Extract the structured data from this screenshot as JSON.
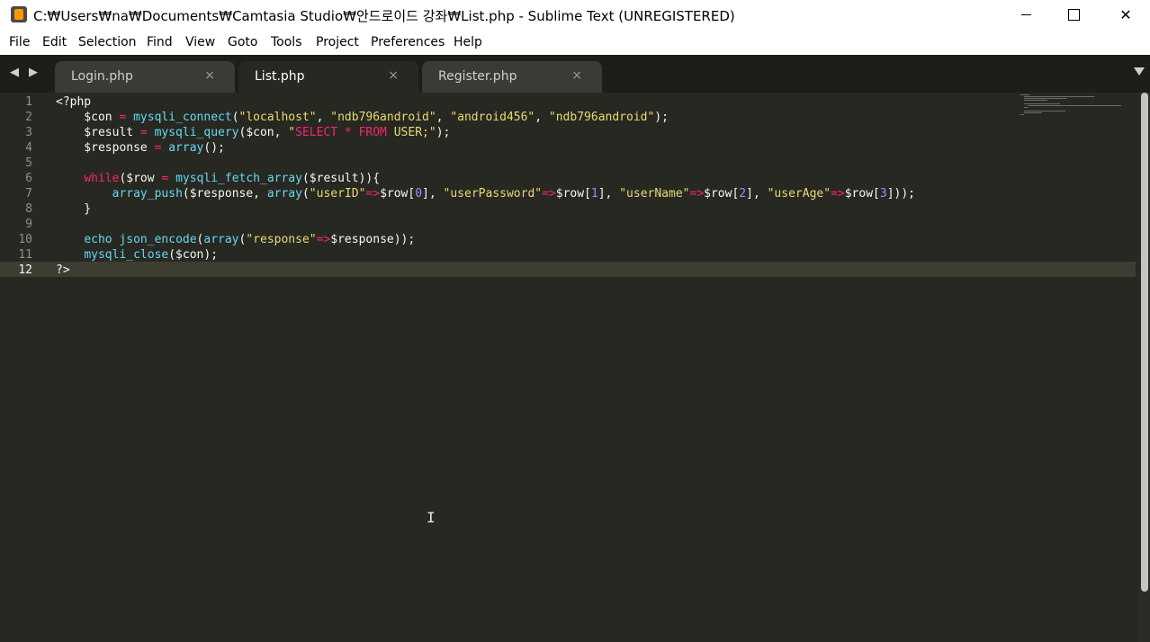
{
  "window": {
    "title": "C:₩Users₩na₩Documents₩Camtasia Studio₩안드로이드 강좌₩List.php - Sublime Text (UNREGISTERED)",
    "minimize_icon": "minimize-icon",
    "maximize_icon": "maximize-icon",
    "close_glyph": "✕"
  },
  "menu": [
    "File",
    "Edit",
    "Selection",
    "Find",
    "View",
    "Goto",
    "Tools",
    "Project",
    "Preferences",
    "Help"
  ],
  "tabs": [
    {
      "label": "Login.php",
      "close": "×",
      "active": false
    },
    {
      "label": "List.php",
      "close": "×",
      "active": true
    },
    {
      "label": "Register.php",
      "close": "×",
      "active": false
    }
  ],
  "nav": {
    "back": "◀",
    "forward": "▶"
  },
  "editor": {
    "current_line": 12,
    "line_numbers": [
      "1",
      "2",
      "3",
      "4",
      "5",
      "6",
      "7",
      "8",
      "9",
      "10",
      "11",
      "12"
    ],
    "lines": [
      [
        {
          "t": "<?php",
          "c": "plain"
        }
      ],
      [
        {
          "t": "    $con ",
          "c": "plain"
        },
        {
          "t": "=",
          "c": "kw"
        },
        {
          "t": " ",
          "c": "plain"
        },
        {
          "t": "mysqli_connect",
          "c": "fn"
        },
        {
          "t": "(",
          "c": "plain"
        },
        {
          "t": "\"localhost\"",
          "c": "str"
        },
        {
          "t": ", ",
          "c": "plain"
        },
        {
          "t": "\"ndb796android\"",
          "c": "str"
        },
        {
          "t": ", ",
          "c": "plain"
        },
        {
          "t": "\"android456\"",
          "c": "str"
        },
        {
          "t": ", ",
          "c": "plain"
        },
        {
          "t": "\"ndb796android\"",
          "c": "str"
        },
        {
          "t": ");",
          "c": "plain"
        }
      ],
      [
        {
          "t": "    $result ",
          "c": "plain"
        },
        {
          "t": "=",
          "c": "kw"
        },
        {
          "t": " ",
          "c": "plain"
        },
        {
          "t": "mysqli_query",
          "c": "fn"
        },
        {
          "t": "($con, ",
          "c": "plain"
        },
        {
          "t": "\"",
          "c": "str"
        },
        {
          "t": "SELECT",
          "c": "kw"
        },
        {
          "t": " ",
          "c": "str"
        },
        {
          "t": "*",
          "c": "kw"
        },
        {
          "t": " ",
          "c": "str"
        },
        {
          "t": "FROM",
          "c": "kw"
        },
        {
          "t": " USER;\"",
          "c": "str"
        },
        {
          "t": ");",
          "c": "plain"
        }
      ],
      [
        {
          "t": "    $response ",
          "c": "plain"
        },
        {
          "t": "=",
          "c": "kw"
        },
        {
          "t": " ",
          "c": "plain"
        },
        {
          "t": "array",
          "c": "fn"
        },
        {
          "t": "();",
          "c": "plain"
        }
      ],
      [
        {
          "t": "",
          "c": "plain"
        }
      ],
      [
        {
          "t": "    ",
          "c": "plain"
        },
        {
          "t": "while",
          "c": "kw"
        },
        {
          "t": "($row ",
          "c": "plain"
        },
        {
          "t": "=",
          "c": "kw"
        },
        {
          "t": " ",
          "c": "plain"
        },
        {
          "t": "mysqli_fetch_array",
          "c": "fn"
        },
        {
          "t": "($result)){",
          "c": "plain"
        }
      ],
      [
        {
          "t": "        ",
          "c": "plain"
        },
        {
          "t": "array_push",
          "c": "fn"
        },
        {
          "t": "($response, ",
          "c": "plain"
        },
        {
          "t": "array",
          "c": "fn"
        },
        {
          "t": "(",
          "c": "plain"
        },
        {
          "t": "\"userID\"",
          "c": "str"
        },
        {
          "t": "=>",
          "c": "kw"
        },
        {
          "t": "$row[",
          "c": "plain"
        },
        {
          "t": "0",
          "c": "num"
        },
        {
          "t": "], ",
          "c": "plain"
        },
        {
          "t": "\"userPassword\"",
          "c": "str"
        },
        {
          "t": "=>",
          "c": "kw"
        },
        {
          "t": "$row[",
          "c": "plain"
        },
        {
          "t": "1",
          "c": "num"
        },
        {
          "t": "], ",
          "c": "plain"
        },
        {
          "t": "\"userName\"",
          "c": "str"
        },
        {
          "t": "=>",
          "c": "kw"
        },
        {
          "t": "$row[",
          "c": "plain"
        },
        {
          "t": "2",
          "c": "num"
        },
        {
          "t": "], ",
          "c": "plain"
        },
        {
          "t": "\"userAge\"",
          "c": "str"
        },
        {
          "t": "=>",
          "c": "kw"
        },
        {
          "t": "$row[",
          "c": "plain"
        },
        {
          "t": "3",
          "c": "num"
        },
        {
          "t": "]));",
          "c": "plain"
        }
      ],
      [
        {
          "t": "    }",
          "c": "plain"
        }
      ],
      [
        {
          "t": "",
          "c": "plain"
        }
      ],
      [
        {
          "t": "    ",
          "c": "plain"
        },
        {
          "t": "echo",
          "c": "fn"
        },
        {
          "t": " ",
          "c": "plain"
        },
        {
          "t": "json_encode",
          "c": "fn"
        },
        {
          "t": "(",
          "c": "plain"
        },
        {
          "t": "array",
          "c": "fn"
        },
        {
          "t": "(",
          "c": "plain"
        },
        {
          "t": "\"response\"",
          "c": "str"
        },
        {
          "t": "=>",
          "c": "kw"
        },
        {
          "t": "$response));",
          "c": "plain"
        }
      ],
      [
        {
          "t": "    ",
          "c": "plain"
        },
        {
          "t": "mysqli_close",
          "c": "fn"
        },
        {
          "t": "($con);",
          "c": "plain"
        }
      ],
      [
        {
          "t": "?>",
          "c": "plain"
        }
      ]
    ]
  },
  "colors": {
    "bg": "#272822",
    "keyword": "#f92672",
    "function": "#66d9ef",
    "string": "#e6db74",
    "number": "#ae81ff",
    "text": "#f8f8f2"
  }
}
